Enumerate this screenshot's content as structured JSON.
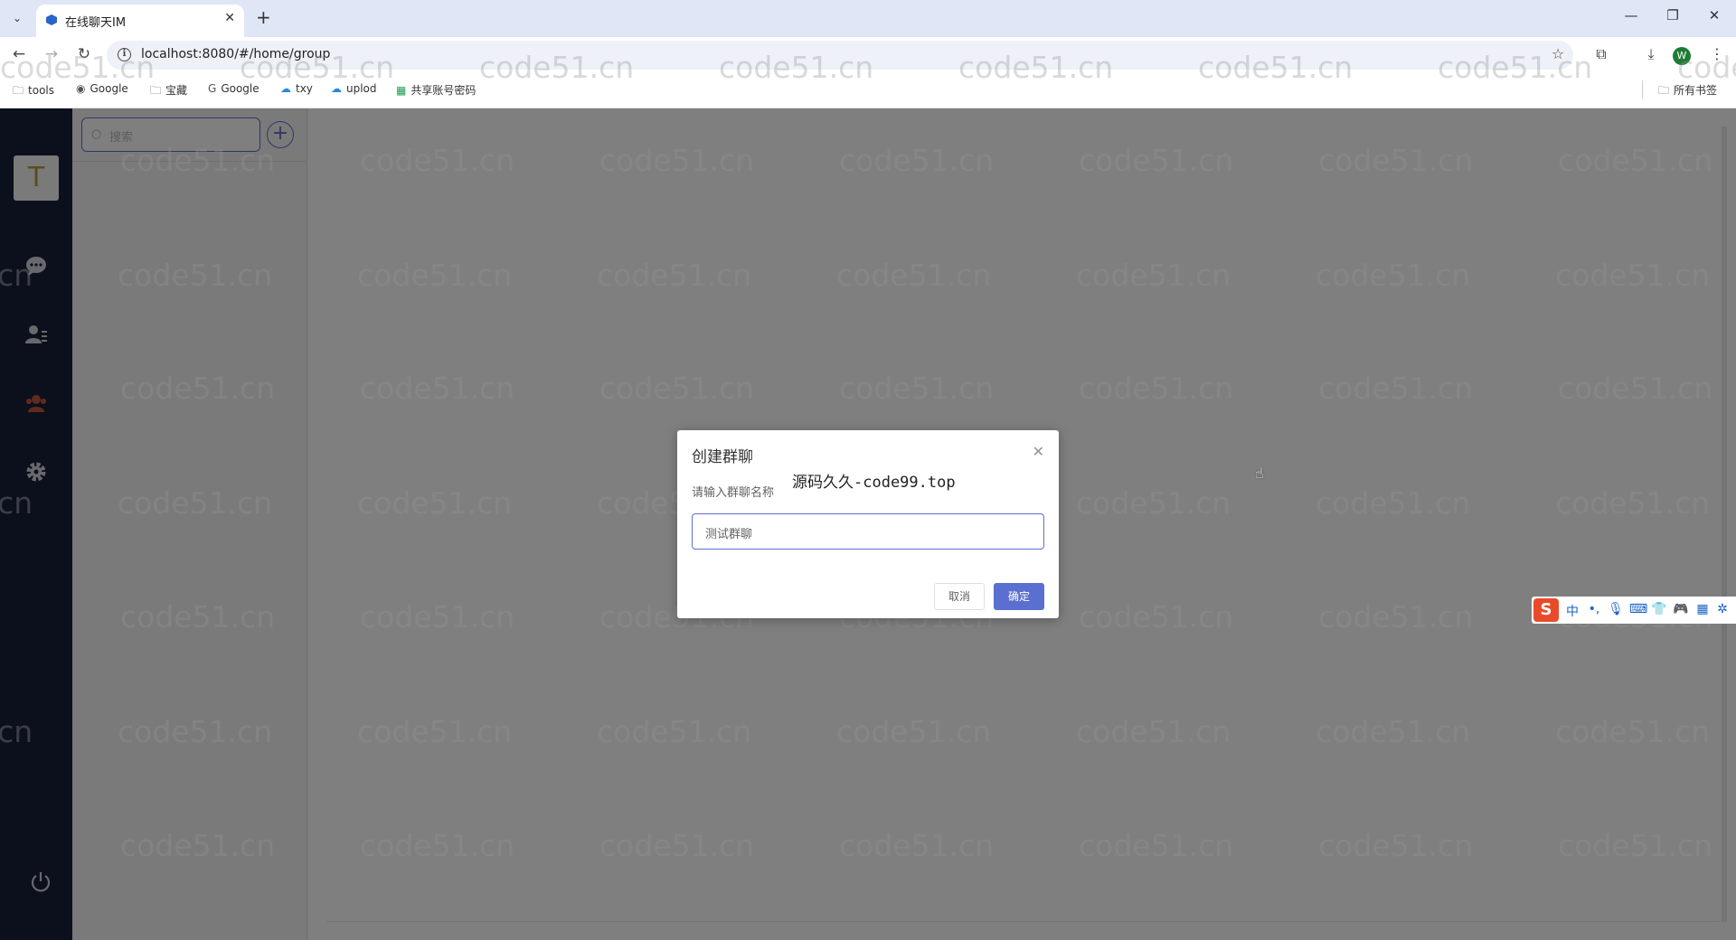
{
  "browser": {
    "tab_title": "在线聊天IM",
    "url": "localhost:8080/#/home/group",
    "profile_initial": "W",
    "bookmarks": [
      {
        "label": "tools",
        "icon": "folder-icon"
      },
      {
        "label": "Google",
        "icon": "globe-icon"
      },
      {
        "label": "宝藏",
        "icon": "folder-icon"
      },
      {
        "label": "Google",
        "icon": "google-icon"
      },
      {
        "label": "txy",
        "icon": "cloud-icon"
      },
      {
        "label": "uplod",
        "icon": "cloud-icon"
      },
      {
        "label": "共享账号密码",
        "icon": "sheet-icon"
      }
    ],
    "all_bookmarks_label": "所有书签"
  },
  "app": {
    "user_avatar_letter": "T",
    "search_placeholder": "搜索",
    "accent_color": "#5b6fd0",
    "nav_bg_color": "#182038"
  },
  "dialog": {
    "title": "创建群聊",
    "label": "请输入群聊名称",
    "input_value": "测试群聊",
    "cancel_label": "取消",
    "confirm_label": "确定"
  },
  "overlay_text": "源码久久-code99.top",
  "watermark_text": "code51.cn",
  "ime": {
    "logo": "S",
    "mode": "中"
  }
}
